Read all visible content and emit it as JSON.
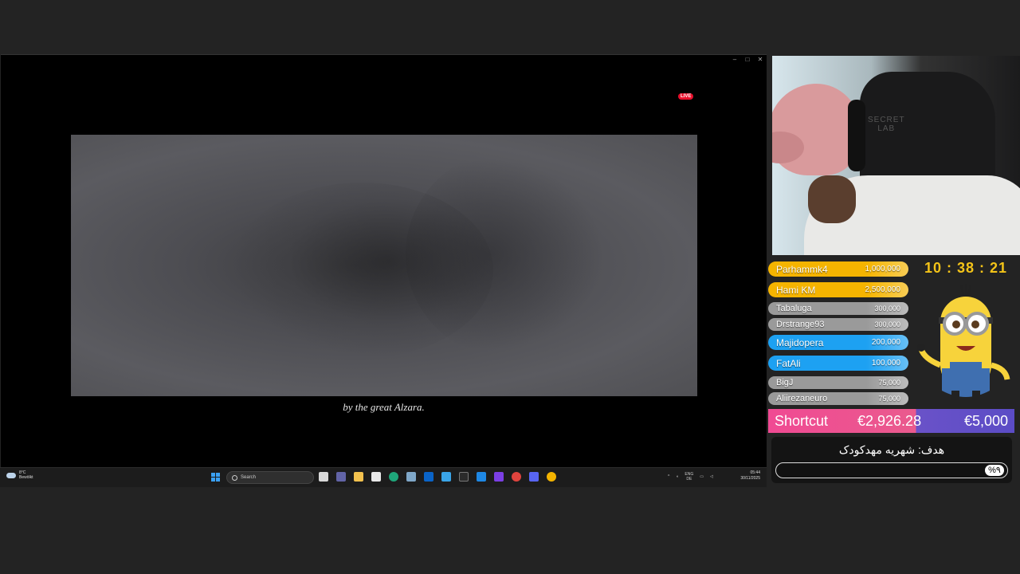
{
  "window": {
    "live_badge": "LIVE",
    "subtitle": "by the great Alzara."
  },
  "taskbar": {
    "weather_temp": "8°C",
    "weather_desc": "Bewölkt",
    "search_placeholder": "Search",
    "lang_top": "ENG",
    "lang_bottom": "DE",
    "time": "05:44",
    "date": "30/11/2025",
    "apps": [
      "task-view-icon",
      "teams-icon",
      "file-explorer-icon",
      "store-icon",
      "edge-icon",
      "desktop-icon",
      "outlook-icon",
      "photos-icon",
      "terminal-icon",
      "vscode-icon",
      "rider-icon",
      "settings-icon",
      "discord-icon",
      "chrome-icon"
    ]
  },
  "overlay": {
    "timer": "10 : 38 : 21",
    "leaderboard": [
      {
        "name": "Parhammk4",
        "amount": "1,000,000",
        "color": "#f5b400"
      },
      {
        "name": "Hami KM",
        "amount": "2,500,000",
        "color": "#f5b400"
      },
      {
        "name": "Tabaluga",
        "amount": "300,000",
        "color": "#9a9a9a"
      },
      {
        "name": "Drstrange93",
        "amount": "300,000",
        "color": "#9a9a9a"
      },
      {
        "name": "Majidopera",
        "amount": "200,000",
        "color": "#1da1f2"
      },
      {
        "name": "FatAli",
        "amount": "100,000",
        "color": "#1da1f2"
      },
      {
        "name": "BigJ",
        "amount": "75,000",
        "color": "#9a9a9a"
      },
      {
        "name": "Aliirezaneuro",
        "amount": "75,000",
        "color": "#9a9a9a"
      }
    ],
    "goal": {
      "label": "Shortcut",
      "current": "€2,926.28",
      "target": "€5,000"
    },
    "persian_goal": {
      "text": "هدف: شهریه مهدکودک",
      "percent": "%۹",
      "progress": 0.09
    }
  }
}
